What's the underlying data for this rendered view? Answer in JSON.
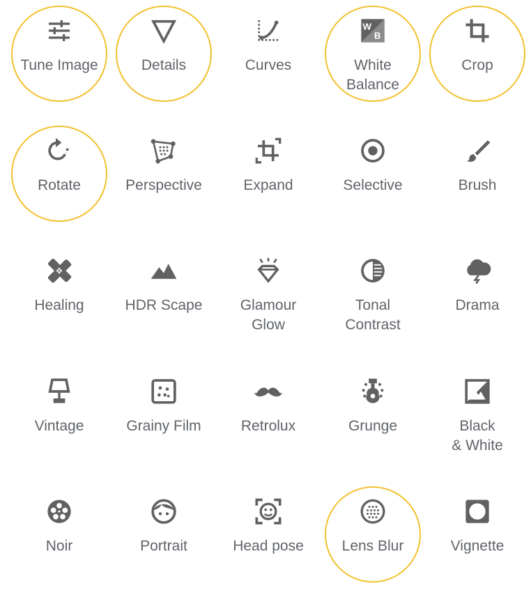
{
  "colors": {
    "icon": "#616161",
    "label": "#5f6368",
    "highlight": "#f2c12e",
    "background": "#ffffff"
  },
  "tools": [
    {
      "id": "tune-image",
      "label": "Tune Image",
      "icon": "tune-icon",
      "highlighted": true
    },
    {
      "id": "details",
      "label": "Details",
      "icon": "triangle-icon",
      "highlighted": true
    },
    {
      "id": "curves",
      "label": "Curves",
      "icon": "curves-icon",
      "highlighted": false
    },
    {
      "id": "white-balance",
      "label": "White\nBalance",
      "icon": "wb-icon",
      "highlighted": true
    },
    {
      "id": "crop",
      "label": "Crop",
      "icon": "crop-icon",
      "highlighted": true
    },
    {
      "id": "rotate",
      "label": "Rotate",
      "icon": "rotate-icon",
      "highlighted": true
    },
    {
      "id": "perspective",
      "label": "Perspective",
      "icon": "perspective-icon",
      "highlighted": false
    },
    {
      "id": "expand",
      "label": "Expand",
      "icon": "expand-icon",
      "highlighted": false
    },
    {
      "id": "selective",
      "label": "Selective",
      "icon": "selective-icon",
      "highlighted": false
    },
    {
      "id": "brush",
      "label": "Brush",
      "icon": "brush-icon",
      "highlighted": false
    },
    {
      "id": "healing",
      "label": "Healing",
      "icon": "healing-icon",
      "highlighted": false
    },
    {
      "id": "hdr-scape",
      "label": "HDR Scape",
      "icon": "mountains-icon",
      "highlighted": false
    },
    {
      "id": "glamour-glow",
      "label": "Glamour\nGlow",
      "icon": "diamond-icon",
      "highlighted": false
    },
    {
      "id": "tonal-contrast",
      "label": "Tonal\nContrast",
      "icon": "tonal-icon",
      "highlighted": false
    },
    {
      "id": "drama",
      "label": "Drama",
      "icon": "storm-cloud-icon",
      "highlighted": false
    },
    {
      "id": "vintage",
      "label": "Vintage",
      "icon": "lamp-icon",
      "highlighted": false
    },
    {
      "id": "grainy-film",
      "label": "Grainy Film",
      "icon": "grain-icon",
      "highlighted": false
    },
    {
      "id": "retrolux",
      "label": "Retrolux",
      "icon": "mustache-icon",
      "highlighted": false
    },
    {
      "id": "grunge",
      "label": "Grunge",
      "icon": "guitar-icon",
      "highlighted": false
    },
    {
      "id": "black-white",
      "label": "Black\n& White",
      "icon": "bw-icon",
      "highlighted": false
    },
    {
      "id": "noir",
      "label": "Noir",
      "icon": "film-reel-icon",
      "highlighted": false
    },
    {
      "id": "portrait",
      "label": "Portrait",
      "icon": "face-icon",
      "highlighted": false
    },
    {
      "id": "head-pose",
      "label": "Head pose",
      "icon": "head-pose-icon",
      "highlighted": false
    },
    {
      "id": "lens-blur",
      "label": "Lens Blur",
      "icon": "lens-blur-icon",
      "highlighted": true
    },
    {
      "id": "vignette",
      "label": "Vignette",
      "icon": "vignette-icon",
      "highlighted": false
    }
  ]
}
